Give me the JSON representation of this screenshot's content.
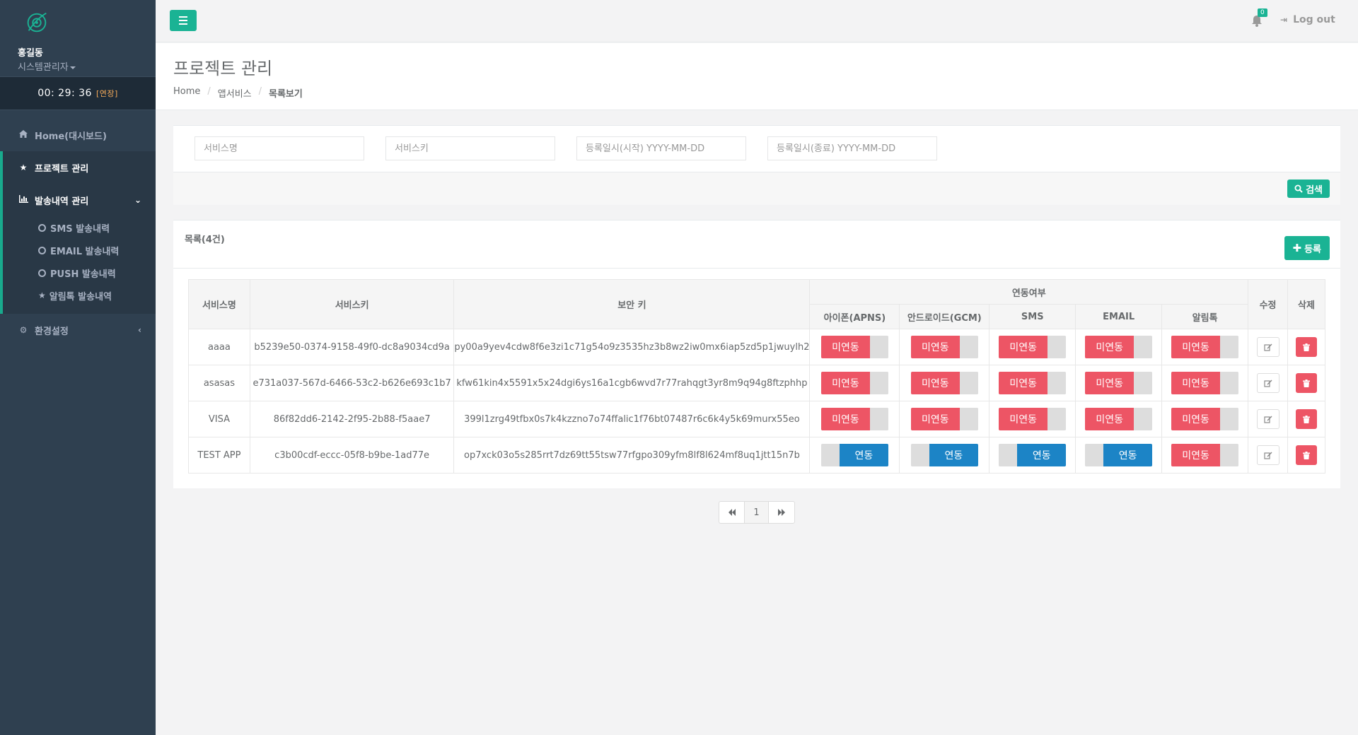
{
  "sidebar": {
    "user_name": "홍길동",
    "user_role": "시스템관리자",
    "timer": "00: 29: 36",
    "timer_extend": "[연장]",
    "nav": {
      "home": "Home(대시보드)",
      "project": "프로젝트 관리",
      "history": "발송내역 관리",
      "sub_sms": "SMS 발송내력",
      "sub_email": "EMAIL 발송내력",
      "sub_push": "PUSH 발송내력",
      "sub_alimtalk": "알림톡 발송내역",
      "settings": "환경설정"
    }
  },
  "topbar": {
    "notification_count": "0",
    "logout_label": "Log out"
  },
  "heading": {
    "title": "프로젝트 관리",
    "crumb_home": "Home",
    "crumb_app": "앱서비스",
    "crumb_current": "목록보기"
  },
  "search": {
    "service_name_placeholder": "서비스명",
    "service_key_placeholder": "서비스키",
    "date_start_placeholder": "등록일시(시작) YYYY-MM-DD",
    "date_end_placeholder": "등록일시(종료) YYYY-MM-DD",
    "search_label": "검색"
  },
  "list": {
    "title": "목록(4건)",
    "add_label": "등록",
    "headers": {
      "service_name": "서비스명",
      "service_key": "서비스키",
      "security_key": "보안 키",
      "linkage": "연동여부",
      "apns": "아이폰(APNS)",
      "gcm": "안드로이드(GCM)",
      "sms": "SMS",
      "email": "EMAIL",
      "alimtalk": "알림톡",
      "edit": "수정",
      "delete": "삭제"
    },
    "on_label": "연동",
    "off_label": "미연동",
    "rows": [
      {
        "name": "aaaa",
        "key": "b5239e50-0374-9158-49f0-dc8a9034cd9a",
        "secret": "py00a9yev4cdw8f6e3zi1c71g54o9z3535hz3b8wz2iw0mx6iap5zd5p1jwuylh2",
        "apns": "미연동",
        "gcm": "미연동",
        "sms": "미연동",
        "email": "미연동",
        "alimtalk": "미연동"
      },
      {
        "name": "asasas",
        "key": "e731a037-567d-6466-53c2-b626e693c1b7",
        "secret": "kfw61kin4x5591x5x24dgi6ys16a1cgb6wvd7r77rahqgt3yr8m9q94g8ftzphhp",
        "apns": "미연동",
        "gcm": "미연동",
        "sms": "미연동",
        "email": "미연동",
        "alimtalk": "미연동"
      },
      {
        "name": "VISA",
        "key": "86f82dd6-2142-2f95-2b88-f5aae7",
        "secret": "399l1zrg49tfbx0s7k4kzzno7o74ffalic1f76bt07487r6c6k4y5k69murx55eo",
        "apns": "미연동",
        "gcm": "미연동",
        "sms": "미연동",
        "email": "미연동",
        "alimtalk": "미연동"
      },
      {
        "name": "TEST APP",
        "key": "c3b00cdf-eccc-05f8-b9be-1ad77e",
        "secret": "op7xck03o5s285rrt7dz69tt55tsw77rfgpo309yfm8lf8l624mf8uq1jtt15n7b",
        "apns": "연동",
        "gcm": "연동",
        "sms": "연동",
        "email": "연동",
        "alimtalk": "미연동"
      }
    ]
  },
  "pager": {
    "current_page": "1"
  },
  "colors": {
    "accent": "#1ab394",
    "sidebar_bg": "#2f4050",
    "toggle_off": "#ed5565",
    "toggle_on": "#1c84c6"
  }
}
